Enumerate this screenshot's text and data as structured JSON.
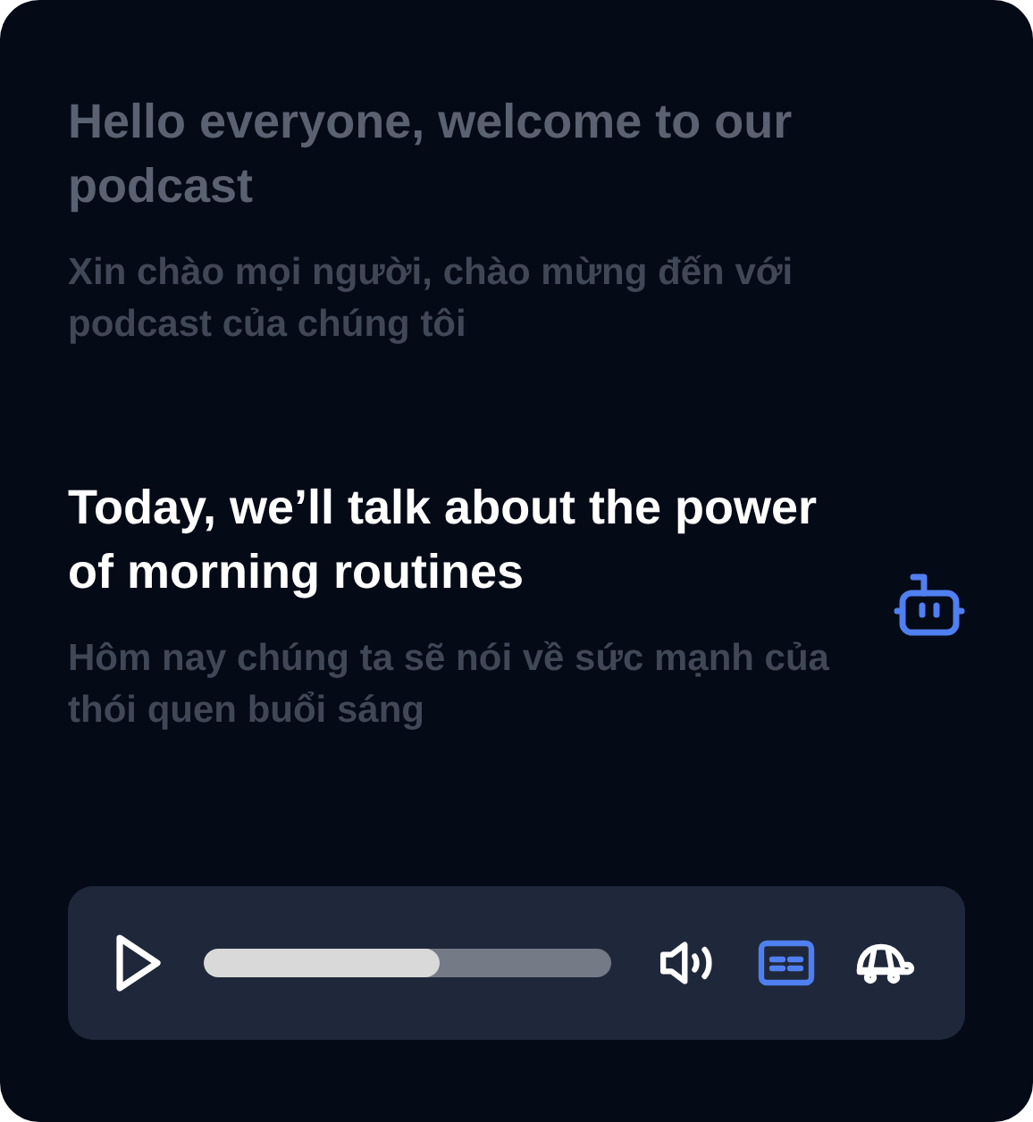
{
  "segments": [
    {
      "text": "Hello everyone, welcome to our podcast",
      "translation": "Xin chào mọi người, chào mừng đến với podcast của chúng tôi",
      "selected": false
    },
    {
      "text": "Today, we’ll talk about the power of morning routines",
      "translation": "Hôm nay chúng ta sẽ nói về sức mạnh của thói quen buổi sáng",
      "selected": true
    }
  ],
  "player": {
    "playing": false,
    "level": 0.58,
    "subtitles_on": true
  }
}
